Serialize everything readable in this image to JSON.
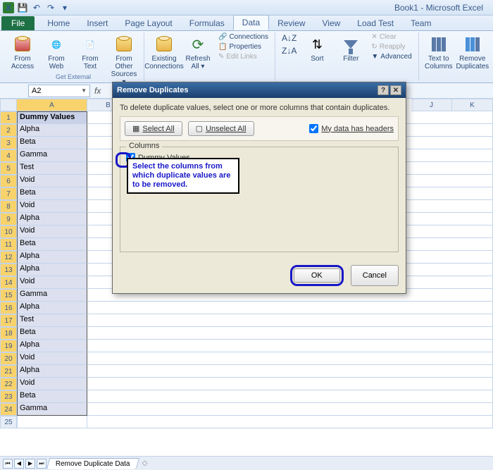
{
  "titlebar": {
    "title": "Book1 - Microsoft Excel"
  },
  "tabs": {
    "file": "File",
    "list": [
      "Home",
      "Insert",
      "Page Layout",
      "Formulas",
      "Data",
      "Review",
      "View",
      "Load Test",
      "Team"
    ],
    "active": "Data"
  },
  "ribbon": {
    "getext": {
      "label": "Get External",
      "btns": [
        {
          "l1": "From",
          "l2": "Access"
        },
        {
          "l1": "From",
          "l2": "Web"
        },
        {
          "l1": "From",
          "l2": "Text"
        },
        {
          "l1": "From Other",
          "l2": "Sources ▾"
        }
      ]
    },
    "conn": {
      "existing_l1": "Existing",
      "existing_l2": "Connections",
      "refresh_l1": "Refresh",
      "refresh_l2": "All ▾",
      "links": [
        "Connections",
        "Properties",
        "Edit Links"
      ]
    },
    "sort": {
      "az": "A→Z",
      "za": "Z→A",
      "sort_l": "Sort",
      "filter_l": "Filter",
      "clear": "Clear",
      "reapply": "Reapply",
      "advanced": "Advanced"
    },
    "tools": {
      "ttc_l1": "Text to",
      "ttc_l2": "Columns",
      "rd_l1": "Remove",
      "rd_l2": "Duplicates"
    }
  },
  "namebox": "A2",
  "columns": [
    "A",
    "B",
    "J",
    "K"
  ],
  "table": {
    "header": "Dummy Values",
    "rows": [
      "Alpha",
      "Beta",
      "Gamma",
      "Test",
      "Void",
      "Beta",
      "Void",
      "Alpha",
      "Void",
      "Beta",
      "Alpha",
      "Alpha",
      "Void",
      "Gamma",
      "Alpha",
      "Test",
      "Beta",
      "Alpha",
      "Void",
      "Alpha",
      "Void",
      "Beta",
      "Gamma"
    ]
  },
  "dialog": {
    "title": "Remove Duplicates",
    "instruction": "To delete duplicate values, select one or more columns that contain duplicates.",
    "select_all": "Select All",
    "unselect_all": "Unselect All",
    "headers_chk": "My data has headers",
    "columns_legend": "Columns",
    "col_item": "Dummy Values",
    "ok": "OK",
    "cancel": "Cancel"
  },
  "callout": "Select the columns from which duplicate values are to be removed.",
  "sheet": {
    "name": "Remove Duplicate Data"
  }
}
